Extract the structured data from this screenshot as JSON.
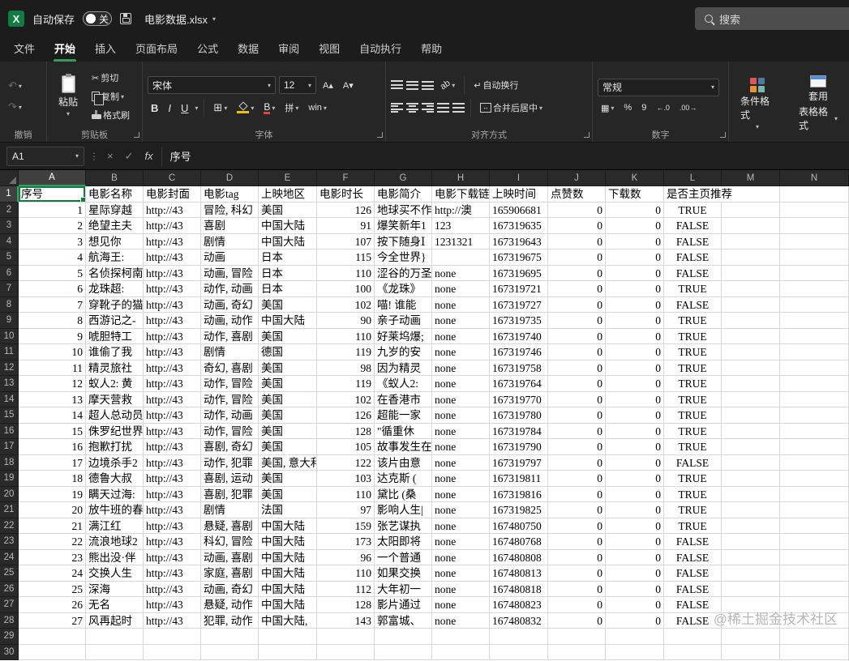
{
  "titlebar": {
    "autosave_label": "自动保存",
    "autosave_state": "关",
    "filename": "电影数据.xlsx",
    "search_placeholder": "搜索"
  },
  "ribbon": {
    "tabs": [
      "文件",
      "开始",
      "插入",
      "页面布局",
      "公式",
      "数据",
      "审阅",
      "视图",
      "自动执行",
      "帮助"
    ],
    "active_tab": "开始",
    "groups": {
      "undo": {
        "label": "撤销"
      },
      "clipboard": {
        "label": "剪贴板",
        "paste": "粘贴",
        "cut": "剪切",
        "copy": "复制",
        "format_painter": "格式刷"
      },
      "font": {
        "label": "字体",
        "font_name": "宋体",
        "font_size": "12"
      },
      "alignment": {
        "label": "对齐方式",
        "wrap_text": "自动换行",
        "merge_center": "合并后居中"
      },
      "number": {
        "label": "数字",
        "format": "常规"
      },
      "styles": {
        "conditional": "条件格式",
        "table_line1": "套用",
        "table_line2": "表格格式"
      }
    }
  },
  "formula_bar": {
    "name_box": "A1",
    "content": "序号"
  },
  "icons": {
    "dropdown": "▾",
    "undo": "↶",
    "redo": "↷",
    "scissors": "✂",
    "bold": "B",
    "italic": "I",
    "underline": "U",
    "borders": "⊞",
    "font_larger": "A▴",
    "font_smaller": "A▾",
    "pinyin": "拼",
    "win": "win",
    "orientation": "ab",
    "wrap": "↵",
    "merge_arrows": "↔",
    "accounting": "▦",
    "percent": "%",
    "comma": "9",
    "inc_decimal": "←.0",
    "dec_decimal": ".00→",
    "close": "×",
    "check": "✓",
    "fx": "fx",
    "grip": "⋮"
  },
  "sheet": {
    "selected_cell": "A1",
    "columns": [
      "A",
      "B",
      "C",
      "D",
      "E",
      "F",
      "G",
      "H",
      "I",
      "J",
      "K",
      "L",
      "M",
      "N"
    ],
    "total_rows": 30,
    "headers": [
      "序号",
      "电影名称",
      "电影封面",
      "电影tag",
      "上映地区",
      "电影时长",
      "电影简介",
      "电影下载链接",
      "上映时间",
      "点赞数",
      "下载数",
      "是否主页推荐"
    ],
    "rows": [
      [
        1,
        "星际穿越",
        "http://43",
        "冒险, 科幻",
        "美国",
        126,
        "地球买不作",
        "http://澳",
        "165906681",
        0,
        0,
        "TRUE"
      ],
      [
        2,
        "绝望主夫",
        "http://43",
        "喜剧",
        "中国大陆",
        91,
        "爆笑新年1",
        "123",
        "167319635",
        0,
        0,
        "FALSE"
      ],
      [
        3,
        "想见你",
        "http://43",
        "剧情",
        "中国大陆",
        107,
        "按下随身Ⅰ",
        "1231321",
        "167319643",
        0,
        0,
        "FALSE"
      ],
      [
        4,
        "航海王:",
        "http://43",
        "动画",
        "日本",
        115,
        "今全世界}",
        "",
        "167319675",
        0,
        0,
        "FALSE"
      ],
      [
        5,
        "名侦探柯南",
        "http://43",
        "动画, 冒险",
        "日本",
        110,
        "涩谷的万圣",
        "none",
        "167319695",
        0,
        0,
        "FALSE"
      ],
      [
        6,
        "龙珠超:",
        "http://43",
        "动作, 动画",
        "日本",
        100,
        "《龙珠》",
        "none",
        "167319721",
        0,
        0,
        "TRUE"
      ],
      [
        7,
        "穿靴子的猫",
        "http://43",
        "动画, 奇幻",
        "美国",
        102,
        "喵! 谁能",
        "none",
        "167319727",
        0,
        0,
        "FALSE"
      ],
      [
        8,
        "西游记之-",
        "http://43",
        "动画, 动作",
        "中国大陆",
        90,
        "亲子动画",
        "none",
        "167319735",
        0,
        0,
        "TRUE"
      ],
      [
        9,
        "唬胆特工",
        "http://43",
        "动作, 喜剧",
        "美国",
        110,
        "好莱坞爆;",
        "none",
        "167319740",
        0,
        0,
        "TRUE"
      ],
      [
        10,
        "谁偷了我",
        "http://43",
        "剧情",
        "德国",
        119,
        "九岁的安",
        "none",
        "167319746",
        0,
        0,
        "TRUE"
      ],
      [
        11,
        "精灵旅社",
        "http://43",
        "奇幻, 喜剧",
        "美国",
        98,
        "因为精灵",
        "none",
        "167319758",
        0,
        0,
        "TRUE"
      ],
      [
        12,
        "蚁人2: 黄",
        "http://43",
        "动作, 冒险",
        "美国",
        119,
        "《蚁人2:",
        "none",
        "167319764",
        0,
        0,
        "TRUE"
      ],
      [
        13,
        "摩天营救",
        "http://43",
        "动作, 冒险",
        "美国",
        102,
        "在香港市",
        "none",
        "167319770",
        0,
        0,
        "TRUE"
      ],
      [
        14,
        "超人总动员",
        "http://43",
        "动作, 动画",
        "美国",
        126,
        "超能一家",
        "none",
        "167319780",
        0,
        0,
        "TRUE"
      ],
      [
        15,
        "侏罗纪世界",
        "http://43",
        "动作, 冒险",
        "美国",
        128,
        "\"循重休",
        "none",
        "167319784",
        0,
        0,
        "TRUE"
      ],
      [
        16,
        "抱歉打扰",
        "http://43",
        "喜剧, 奇幻",
        "美国",
        105,
        "故事发生在",
        "none",
        "167319790",
        0,
        0,
        "TRUE"
      ],
      [
        17,
        "边境杀手2",
        "http://43",
        "动作, 犯罪",
        "美国, 意大利",
        122,
        "该片由意",
        "none",
        "167319797",
        0,
        0,
        "FALSE"
      ],
      [
        18,
        "德鲁大叔",
        "http://43",
        "喜剧, 运动",
        "美国",
        103,
        "达克斯 (",
        "none",
        "167319811",
        0,
        0,
        "TRUE"
      ],
      [
        19,
        "瞒天过海:",
        "http://43",
        "喜剧, 犯罪",
        "美国",
        110,
        "黛比 (桑",
        "none",
        "167319816",
        0,
        0,
        "TRUE"
      ],
      [
        20,
        "放牛班的春",
        "http://43",
        "剧情",
        "法国",
        97,
        "影响人生|",
        "none",
        "167319825",
        0,
        0,
        "TRUE"
      ],
      [
        21,
        "满江红",
        "http://43",
        "悬疑, 喜剧",
        "中国大陆",
        159,
        "张艺谋执",
        "none",
        "167480750",
        0,
        0,
        "TRUE"
      ],
      [
        22,
        "流浪地球2",
        "http://43",
        "科幻, 冒险",
        "中国大陆",
        173,
        "太阳即将",
        "none",
        "167480768",
        0,
        0,
        "FALSE"
      ],
      [
        23,
        "熊出没·伴",
        "http://43",
        "动画, 喜剧",
        "中国大陆",
        96,
        "一个普通",
        "none",
        "167480808",
        0,
        0,
        "FALSE"
      ],
      [
        24,
        "交换人生",
        "http://43",
        "家庭, 喜剧",
        "中国大陆",
        110,
        "如果交换",
        "none",
        "167480813",
        0,
        0,
        "FALSE"
      ],
      [
        25,
        "深海",
        "http://43",
        "动画, 奇幻",
        "中国大陆",
        112,
        "大年初一",
        "none",
        "167480818",
        0,
        0,
        "FALSE"
      ],
      [
        26,
        "无名",
        "http://43",
        "悬疑, 动作",
        "中国大陆",
        128,
        "影片通过",
        "none",
        "167480823",
        0,
        0,
        "FALSE"
      ],
      [
        27,
        "风再起时",
        "http://43",
        "犯罪, 动作",
        "中国大陆,",
        143,
        "郭富城、",
        "none",
        "167480832",
        0,
        0,
        "FALSE"
      ]
    ]
  },
  "watermark": "@稀土掘金技术社区"
}
